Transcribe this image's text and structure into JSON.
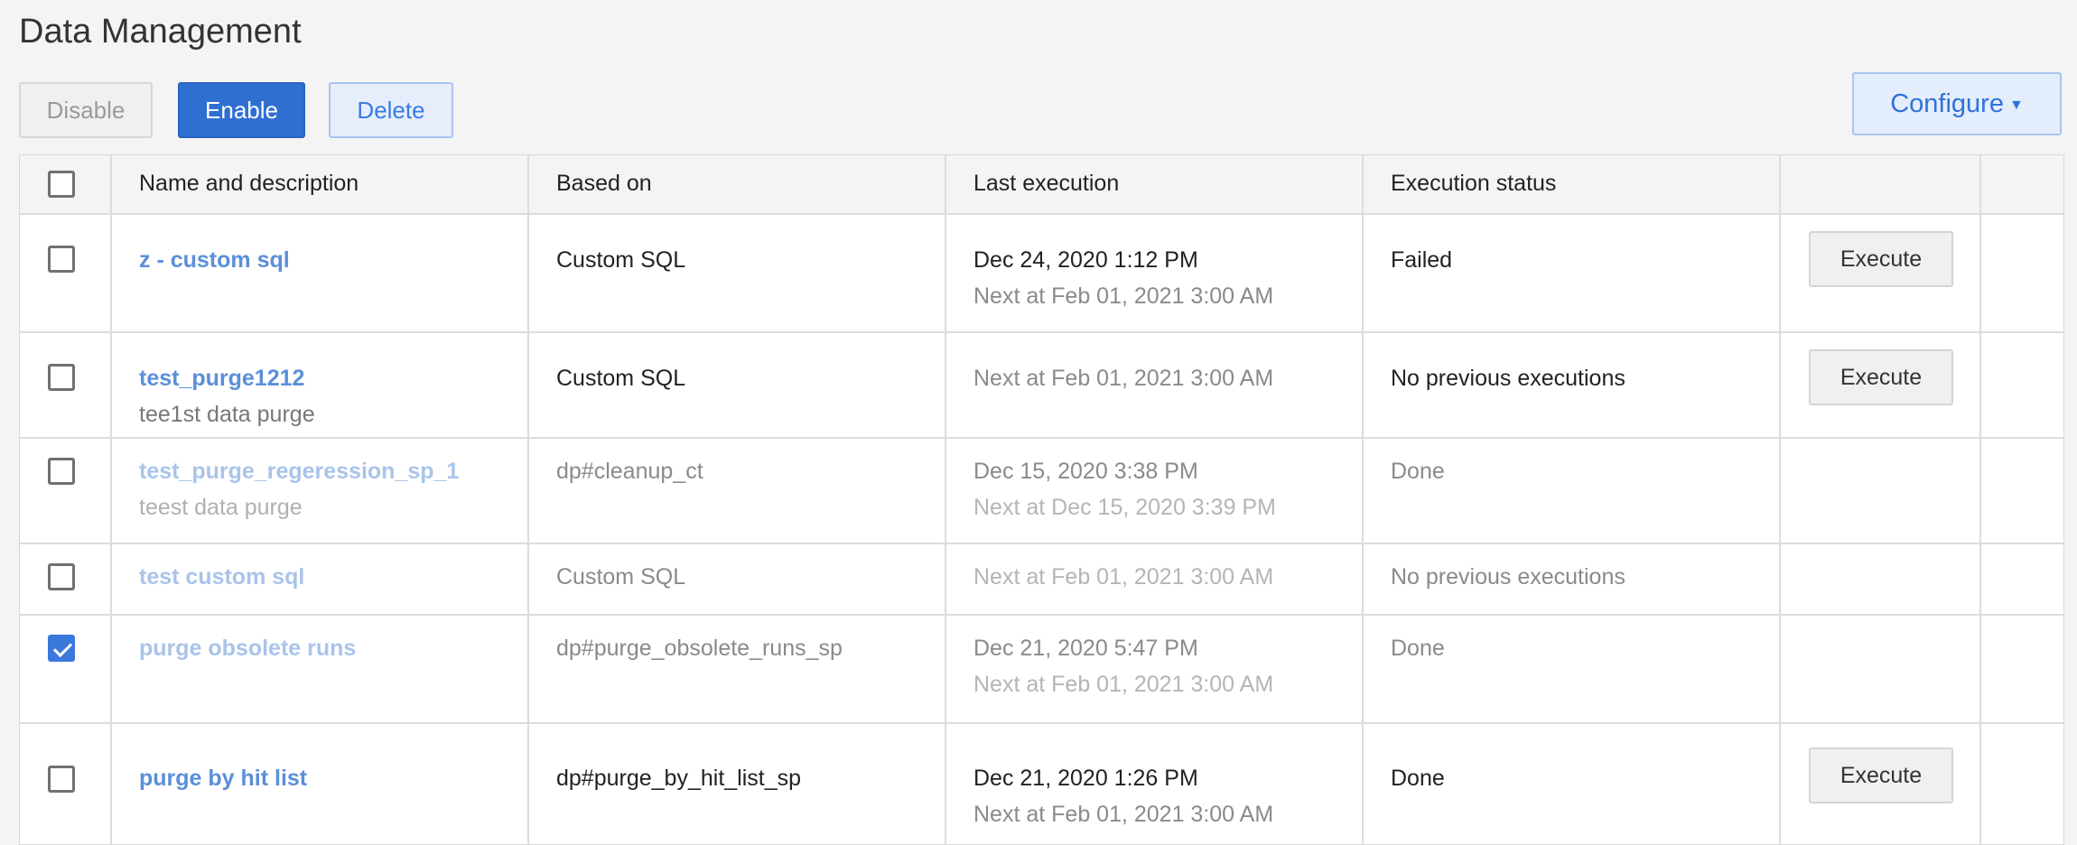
{
  "page": {
    "title": "Data Management"
  },
  "toolbar": {
    "disable_label": "Disable",
    "enable_label": "Enable",
    "delete_label": "Delete",
    "configure_label": "Configure"
  },
  "table": {
    "headers": [
      "Name and description",
      "Based on",
      "Last execution",
      "Execution status",
      "",
      ""
    ],
    "execute_label": "Execute",
    "rows": [
      {
        "name": "z - custom sql",
        "desc": "",
        "based_on": "Custom SQL",
        "last_exec": "Dec 24, 2020 1:12 PM",
        "next_exec": "Next at Feb 01, 2021 3:00 AM",
        "status": "Failed",
        "checked": false,
        "enabled": true,
        "has_execute": true
      },
      {
        "name": "test_purge1212",
        "desc": "tee1st data purge",
        "based_on": "Custom SQL",
        "last_exec": "",
        "next_exec": "Next at Feb 01, 2021 3:00 AM",
        "status": "No previous executions",
        "checked": false,
        "enabled": true,
        "has_execute": true
      },
      {
        "name": "test_purge_regeression_sp_1",
        "desc": "teest data purge",
        "based_on": "dp#cleanup_ct",
        "last_exec": "Dec 15, 2020 3:38 PM",
        "next_exec": "Next at Dec 15, 2020 3:39 PM",
        "status": "Done",
        "checked": false,
        "enabled": false,
        "has_execute": false
      },
      {
        "name": "test custom sql",
        "desc": "",
        "based_on": "Custom SQL",
        "last_exec": "",
        "next_exec": "Next at Feb 01, 2021 3:00 AM",
        "status": "No previous executions",
        "checked": false,
        "enabled": false,
        "has_execute": false
      },
      {
        "name": "purge obsolete runs",
        "desc": "",
        "based_on": "dp#purge_obsolete_runs_sp",
        "last_exec": "Dec 21, 2020 5:47 PM",
        "next_exec": "Next at Feb 01, 2021 3:00 AM",
        "status": "Done",
        "checked": true,
        "enabled": false,
        "has_execute": false
      },
      {
        "name": "purge by hit list",
        "desc": "",
        "based_on": "dp#purge_by_hit_list_sp",
        "last_exec": "Dec 21, 2020 1:26 PM",
        "next_exec": "Next at Feb 01, 2021 3:00 AM",
        "status": "Done",
        "checked": false,
        "enabled": true,
        "has_execute": true
      }
    ]
  },
  "colors": {
    "primary": "#2f6fd1",
    "link": "#5b8fd8",
    "link_disabled": "#a9c4ea"
  }
}
